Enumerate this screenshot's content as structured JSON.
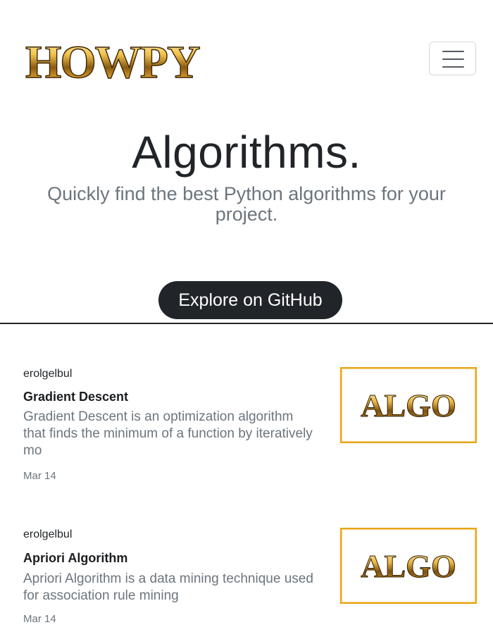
{
  "brand": {
    "logo_text": "HOWPY"
  },
  "header": {
    "menu_icon": "hamburger-menu-icon"
  },
  "hero": {
    "title": "Algorithms.",
    "subtitle": "Quickly find the best Python algorithms for your project.",
    "cta_label": "Explore on GitHub"
  },
  "posts": [
    {
      "author": "erolgelbul",
      "title": "Gradient Descent",
      "excerpt": "Gradient Descent is an optimization algorithm that finds the minimum of a function by iteratively mo",
      "date": "Mar 14",
      "thumb_text": "ALGO"
    },
    {
      "author": "erolgelbul",
      "title": "Apriori Algorithm",
      "excerpt": "Apriori Algorithm is a data mining technique used for association rule mining",
      "date": "Mar 14",
      "thumb_text": "ALGO"
    }
  ],
  "colors": {
    "primary_dark": "#212529",
    "muted_text": "#6c757d",
    "gold": "#e9a41a"
  }
}
